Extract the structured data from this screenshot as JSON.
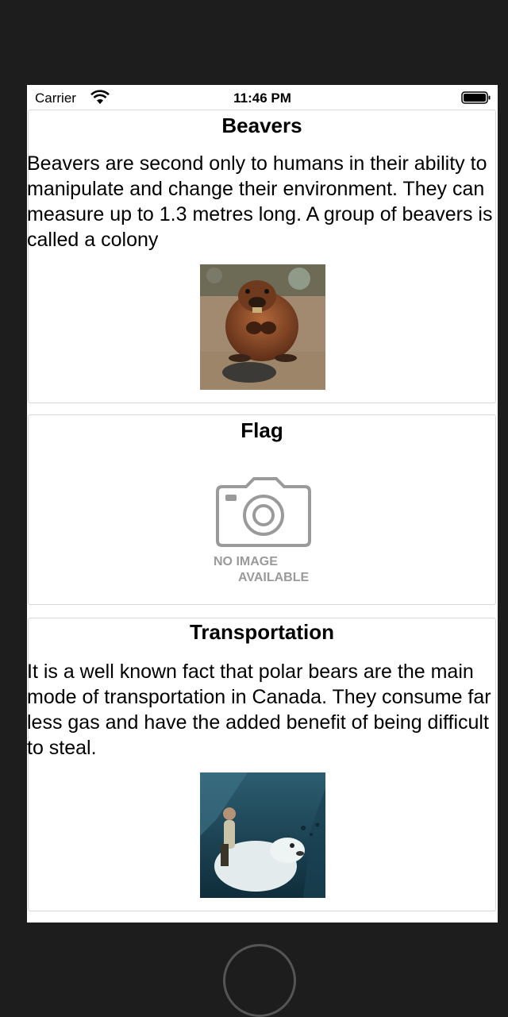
{
  "status_bar": {
    "carrier": "Carrier",
    "time": "11:46 PM"
  },
  "cards": [
    {
      "title": "Beavers",
      "body": "Beavers are second only to humans in their ability to manipulate and change their environment. They can measure up to 1.3 metres long. A group of beavers is called a colony",
      "image": "beaver-photo"
    },
    {
      "title": "Flag",
      "placeholder_line1": "NO IMAGE",
      "placeholder_line2": "AVAILABLE",
      "image": "camera-icon"
    },
    {
      "title": "Transportation",
      "body": "It is a well known fact that polar bears are the main mode of transportation in Canada. They consume far less gas and have the added benefit of being difficult to steal.",
      "image": "polar-bear-rider-photo"
    }
  ]
}
